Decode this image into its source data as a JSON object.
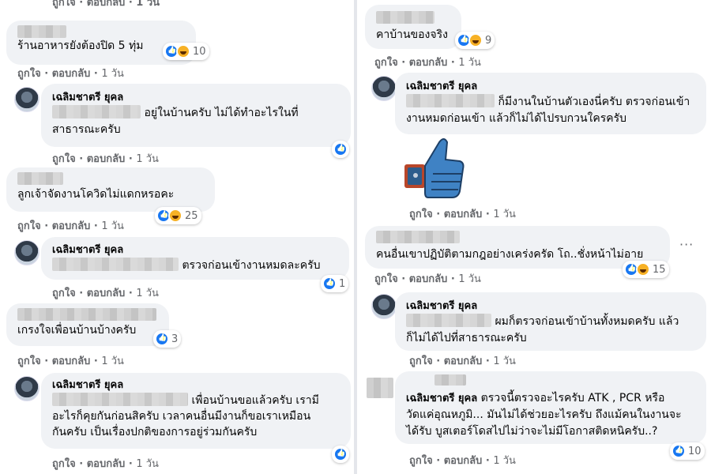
{
  "actions": {
    "like": "ถูกใจ",
    "reply": "ตอบกลับ",
    "time": "1 วัน"
  },
  "colors": {
    "bubble": "#f0f2f5",
    "like": "#1877f2",
    "haha": "#f7b125"
  },
  "left": {
    "top_actions": "ถูกใจ · ตอบกลับ · 1 วัน",
    "c1": {
      "text": "ร้านอาหารยังต้องปิด 5 ทุ่ม",
      "reactions": "10"
    },
    "c2": {
      "name": "เฉลิมชาตรี ยุคล",
      "text_a": "อยู่ในบ้านครับ ไม่ได้ทำอะไรในที่",
      "text_b": "สาธารณะครับ"
    },
    "c3": {
      "text": "ลูกเจ้าจัดงานโควิดไม่แดกหรอคะ",
      "reactions": "25"
    },
    "c4": {
      "name": "เฉลิมชาตรี ยุคล",
      "text": "ตรวจก่อนเข้างานหมดละครับ",
      "reactions": "1"
    },
    "c5": {
      "text": "เกรงใจเพื่อนบ้านบ้างครับ",
      "reactions": "3"
    },
    "c6": {
      "name": "เฉลิมชาตรี ยุคล",
      "text_a": "เพื่อนบ้านขอแล้วครับ เรามี",
      "text_b": "อะไรก็คุยกันก่อนสิครับ เวลาคนอื่นมีงานก็ขอเราเหมือน",
      "text_c": "กันครับ เป็นเรื่องปกติของการอยู่ร่วมกันครับ"
    }
  },
  "right": {
    "c1": {
      "text": "คาบ้านของจริง",
      "reactions": "9"
    },
    "c2": {
      "name": "เฉลิมชาตรี ยุคล",
      "text_a": "ก็มีงานในบ้านตัวเองนี่ครับ ตรวจก่อนเข้า",
      "text_b": "งานหมดก่อนเข้า แล้วก็ไม่ได้ไปรบกวนใครครับ"
    },
    "c3": {
      "text": "คนอื่นเขาปฏิบัติตามกฎอย่างเคร่งครัด โถ..ชั่งหน้าไม่อาย",
      "reactions": "15",
      "more": "···"
    },
    "c4": {
      "name": "เฉลิมชาตรี ยุคล",
      "text_a": "ผมก็ตรวจก่อนเข้าบ้านทั้งหมดครับ แล้ว",
      "text_b": "ก็ไม่ได้ไปที่สาธารณะครับ"
    },
    "c5": {
      "name": "เฉลิมชาตรี ยุคล",
      "text_a": "ตรวจนี้ตรวจอะไรครับ ATK , PCR หรือ",
      "text_b": "วัดแค่อุณหภูมิ... มันไม่ได้ช่วยอะไรครับ ถึงแม้คนในงานจะ",
      "text_c": "ได้รับ บูสเตอร์โดสไปไม่ว่าจะไม่มีโอกาสติดหนิครับ..?",
      "reactions": "10"
    }
  }
}
